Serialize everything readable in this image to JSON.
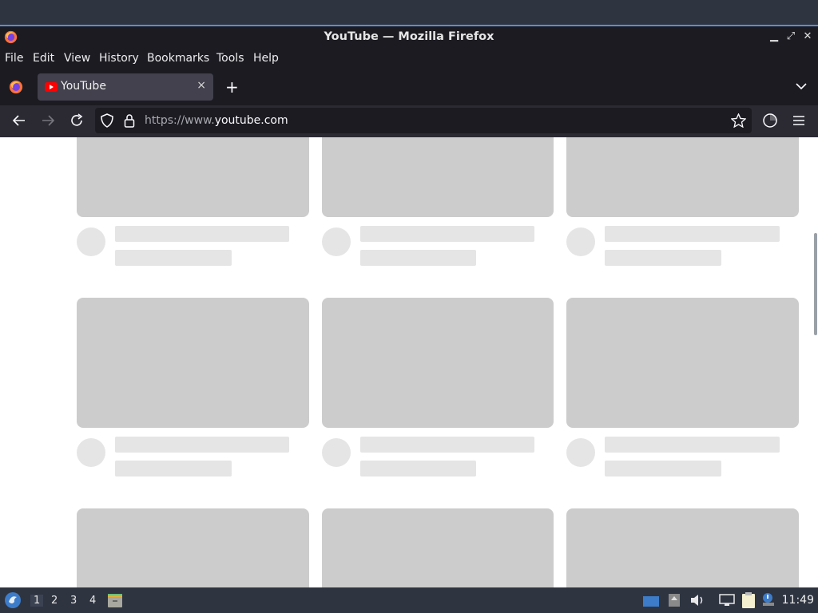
{
  "window": {
    "title": "YouTube — Mozilla Firefox"
  },
  "menu": [
    "File",
    "Edit",
    "View",
    "History",
    "Bookmarks",
    "Tools",
    "Help"
  ],
  "tab": {
    "label": "YouTube",
    "close": "×"
  },
  "newtab": "+",
  "url": {
    "prefix": "https://www.",
    "domain": "youtube.com"
  },
  "taskbar": {
    "workspaces": [
      "1",
      "2",
      "3",
      "4"
    ],
    "active_workspace": "1",
    "clock": "11:49"
  },
  "colors": {
    "accent": "#5b8dd6",
    "placeholder": "#cccccc",
    "placeholder_light": "#e5e5e5"
  }
}
